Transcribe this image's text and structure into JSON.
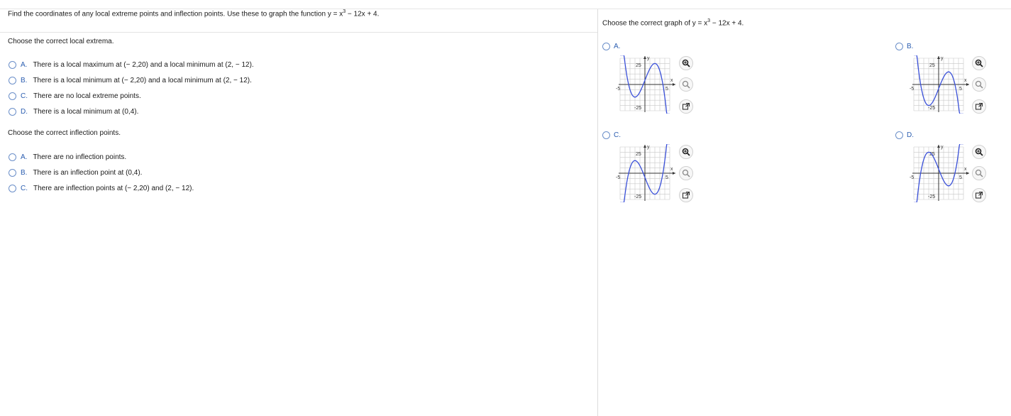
{
  "problem": {
    "prompt_pre": "Find the coordinates of any local extreme points and inflection points. Use these to graph the function y = x",
    "prompt_exp": "3",
    "prompt_post": " − 12x + 4."
  },
  "extrema": {
    "question": "Choose the correct local extrema.",
    "options": [
      {
        "letter": "A.",
        "text": "There is a local maximum at (− 2,20) and a local minimum at (2, − 12)."
      },
      {
        "letter": "B.",
        "text": "There is a local minimum at (− 2,20) and a local minimum at (2, − 12)."
      },
      {
        "letter": "C.",
        "text": "There are no local extreme points."
      },
      {
        "letter": "D.",
        "text": "There is a local minimum at (0,4)."
      }
    ]
  },
  "inflection": {
    "question": "Choose the correct inflection points.",
    "options": [
      {
        "letter": "A.",
        "text": "There are no inflection points."
      },
      {
        "letter": "B.",
        "text": "There is an inflection point at (0,4)."
      },
      {
        "letter": "C.",
        "text": "There are inflection points at (− 2,20) and (2, − 12)."
      }
    ]
  },
  "graph_question": {
    "prompt_pre": "Choose the correct graph of y = x",
    "prompt_exp": "3",
    "prompt_post": " − 12x + 4.",
    "options": [
      {
        "letter": "A.",
        "curve": "neg-cubic"
      },
      {
        "letter": "B.",
        "curve": "neg-cubic-shift"
      },
      {
        "letter": "C.",
        "curve": "pos-cubic-shift"
      },
      {
        "letter": "D.",
        "curve": "pos-cubic"
      }
    ],
    "axis": {
      "y_tick": "25",
      "y_tick_neg": "-25",
      "x_tick": "5",
      "x_tick_neg": "-5",
      "x_label": "x",
      "y_label": "y"
    },
    "tools": [
      "zoom-in-icon",
      "zoom-out-icon",
      "open-new-window-icon"
    ]
  },
  "colors": {
    "curve": "#3a50d9",
    "link": "#2a5db0",
    "grid": "#c8c8c8"
  }
}
